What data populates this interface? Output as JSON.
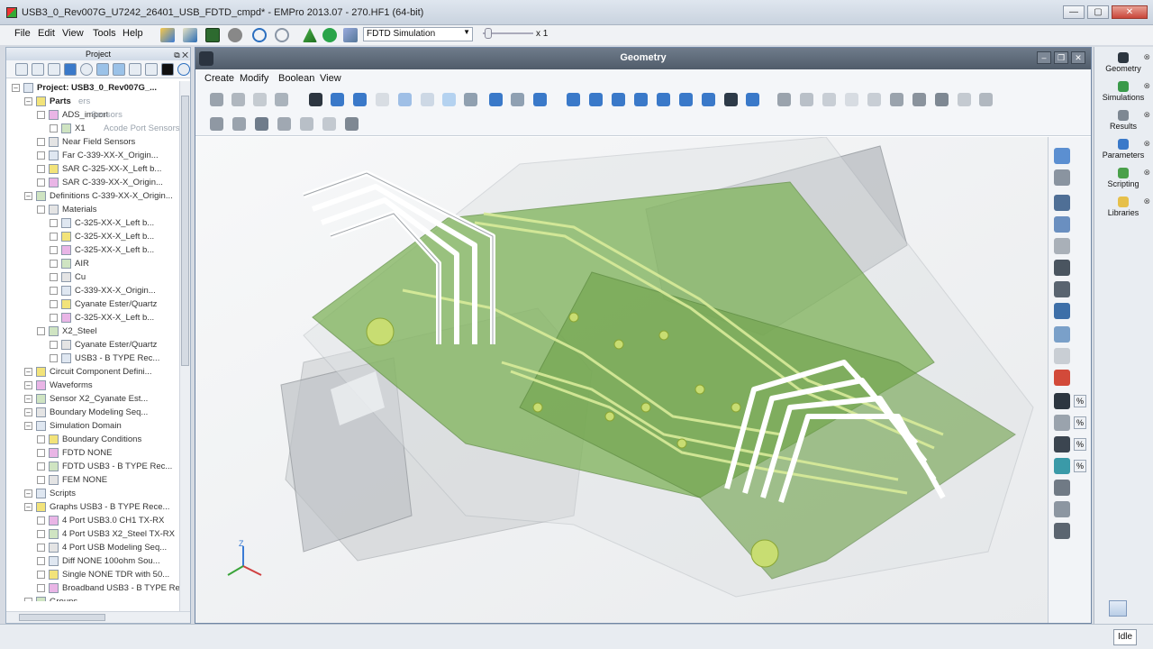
{
  "window": {
    "title": "USB3_0_Rev007G_U7242_26401_USB_FDTD_cmpd* - EMPro 2013.07 - 270.HF1 (64-bit)",
    "controls": [
      "—",
      "▢",
      "✕"
    ]
  },
  "menubar": {
    "items": [
      "File",
      "Edit",
      "View",
      "Tools",
      "Help"
    ]
  },
  "toolbar": {
    "simulation_mode": "FDTD Simulation",
    "zoom_label": "x 1"
  },
  "project": {
    "header": "Project",
    "tree": [
      {
        "label": "Project: USB3_0_Rev007G_...",
        "ghost": "",
        "indent": 0,
        "bold": true
      },
      {
        "label": "Parts",
        "ghost": "ers",
        "indent": 1,
        "bold": true
      },
      {
        "label": "ADS_import",
        "ghost": "Sensors",
        "indent": 2,
        "bold": false
      },
      {
        "label": "X1",
        "ghost": "Acode Port Sensors",
        "indent": 3,
        "bold": false
      },
      {
        "label": "Near Field Sensors",
        "ghost": "",
        "indent": 2,
        "bold": false
      },
      {
        "label": "Far C-339-XX-X_Origin...",
        "ghost": "",
        "indent": 2,
        "bold": false
      },
      {
        "label": "SAR C-325-XX-X_Left b...",
        "ghost": "",
        "indent": 2,
        "bold": false
      },
      {
        "label": "SAR C-339-XX-X_Origin...",
        "ghost": "",
        "indent": 2,
        "bold": false
      },
      {
        "label": "Definitions C-339-XX-X_Origin...",
        "ghost": "",
        "indent": 1,
        "bold": false
      },
      {
        "label": "Materials",
        "ghost": "",
        "indent": 2,
        "bold": false
      },
      {
        "label": "C-325-XX-X_Left b...",
        "ghost": "",
        "indent": 3,
        "bold": false
      },
      {
        "label": "C-325-XX-X_Left b...",
        "ghost": "",
        "indent": 3,
        "bold": false
      },
      {
        "label": "C-325-XX-X_Left b...",
        "ghost": "",
        "indent": 3,
        "bold": false
      },
      {
        "label": "AIR",
        "ghost": "",
        "indent": 3,
        "bold": false
      },
      {
        "label": "Cu",
        "ghost": "",
        "indent": 3,
        "bold": false
      },
      {
        "label": "C-339-XX-X_Origin...",
        "ghost": "",
        "indent": 3,
        "bold": false
      },
      {
        "label": "Cyanate Ester/Quartz",
        "ghost": "",
        "indent": 3,
        "bold": false
      },
      {
        "label": "C-325-XX-X_Left b...",
        "ghost": "",
        "indent": 3,
        "bold": false
      },
      {
        "label": "X2_Steel",
        "ghost": "",
        "indent": 2,
        "bold": false
      },
      {
        "label": "Cyanate Ester/Quartz",
        "ghost": "",
        "indent": 3,
        "bold": false
      },
      {
        "label": "USB3 - B TYPE Rec...",
        "ghost": "",
        "indent": 3,
        "bold": false
      },
      {
        "label": "Circuit Component Defini...",
        "ghost": "",
        "indent": 1,
        "bold": false
      },
      {
        "label": "Waveforms",
        "ghost": "",
        "indent": 1,
        "bold": false
      },
      {
        "label": "Sensor X2_Cyanate Est...",
        "ghost": "",
        "indent": 1,
        "bold": false
      },
      {
        "label": "Boundary Modeling Seq...",
        "ghost": "",
        "indent": 1,
        "bold": false
      },
      {
        "label": "Simulation Domain",
        "ghost": "",
        "indent": 1,
        "bold": false
      },
      {
        "label": "Boundary Conditions",
        "ghost": "",
        "indent": 2,
        "bold": false
      },
      {
        "label": "FDTD NONE",
        "ghost": "",
        "indent": 2,
        "bold": false
      },
      {
        "label": "FDTD USB3 - B TYPE Rec...",
        "ghost": "",
        "indent": 2,
        "bold": false
      },
      {
        "label": "FEM NONE",
        "ghost": "",
        "indent": 2,
        "bold": false
      },
      {
        "label": "Scripts",
        "ghost": "",
        "indent": 1,
        "bold": false
      },
      {
        "label": "Graphs USB3 - B TYPE Rece...",
        "ghost": "",
        "indent": 1,
        "bold": false
      },
      {
        "label": "4 Port USB3.0 CH1 TX-RX",
        "ghost": "",
        "indent": 2,
        "bold": false
      },
      {
        "label": "4 Port USB3 X2_Steel TX-RX",
        "ghost": "",
        "indent": 2,
        "bold": false
      },
      {
        "label": "4 Port USB Modeling Seq...",
        "ghost": "",
        "indent": 2,
        "bold": false
      },
      {
        "label": "Diff NONE 100ohm Sou...",
        "ghost": "",
        "indent": 2,
        "bold": false
      },
      {
        "label": "Single NONE TDR with 50...",
        "ghost": "",
        "indent": 2,
        "bold": false
      },
      {
        "label": "Broadband USB3 - B TYPE Rece...",
        "ghost": "",
        "indent": 2,
        "bold": false
      },
      {
        "label": "Groups",
        "ghost": "",
        "indent": 1,
        "bold": false
      }
    ]
  },
  "geometry": {
    "title": "Geometry",
    "menu": [
      "Create",
      "Modify",
      "Boolean",
      "View"
    ],
    "axis_label": "Z"
  },
  "dock": {
    "items": [
      "Geometry",
      "Simulations",
      "Results",
      "Parameters",
      "Scripting",
      "Libraries"
    ],
    "percent": "%"
  },
  "status": {
    "state": "Idle"
  },
  "colors": {
    "board_green": "#6fa24a",
    "trace": "#c9e07a",
    "chrome": "#d6dbe3"
  }
}
